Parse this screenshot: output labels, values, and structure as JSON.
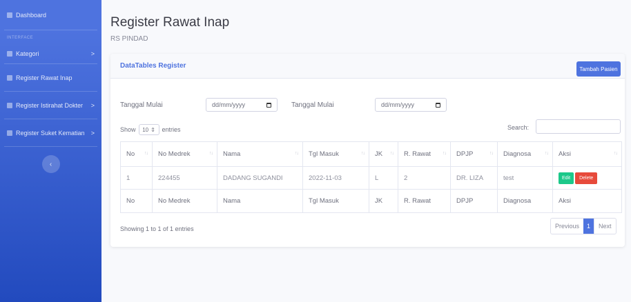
{
  "sidebar": {
    "dashboard": "Dashboard",
    "heading": "INTERFACE",
    "items": [
      {
        "label": "Kategori",
        "chevron": ">"
      },
      {
        "label": "Register Rawat Inap",
        "chevron": ""
      },
      {
        "label": "Register Istirahat Dokter",
        "chevron": ">"
      },
      {
        "label": "Register Suket Kematian",
        "chevron": ">"
      }
    ],
    "toggle": "‹"
  },
  "header": {
    "title": "Register Rawat Inap",
    "subtitle": "RS PINDAD"
  },
  "card": {
    "title": "DataTables Register",
    "add_button": "Tambah Pasien"
  },
  "filters": [
    {
      "label": "Tanggal Mulai",
      "placeholder": "dd/mm/yyyy"
    },
    {
      "label": "Tanggal Mulai",
      "placeholder": "dd/mm/yyyy"
    }
  ],
  "length": {
    "show": "Show",
    "value": "10",
    "entries": "entries"
  },
  "search": {
    "label": "Search:"
  },
  "table": {
    "columns": [
      "No",
      "No Medrek",
      "Nama",
      "Tgl Masuk",
      "JK",
      "R. Rawat",
      "DPJP",
      "Diagnosa",
      "Aksi"
    ],
    "rows": [
      [
        "1",
        "224455",
        "DADANG SUGANDI",
        "2022-11-03",
        "L",
        "2",
        "DR. LIZA",
        "test"
      ]
    ],
    "actions": {
      "edit": "Edit",
      "delete": "Delete"
    }
  },
  "info": "Showing 1 to 1 of 1 entries",
  "pagination": {
    "previous": "Previous",
    "current": "1",
    "next": "Next"
  },
  "colors": {
    "sidebar_top": "#4e73df",
    "sidebar_bottom": "#224abe",
    "primary": "#4e73df",
    "success": "#1cc88a",
    "danger": "#e74a3b"
  }
}
